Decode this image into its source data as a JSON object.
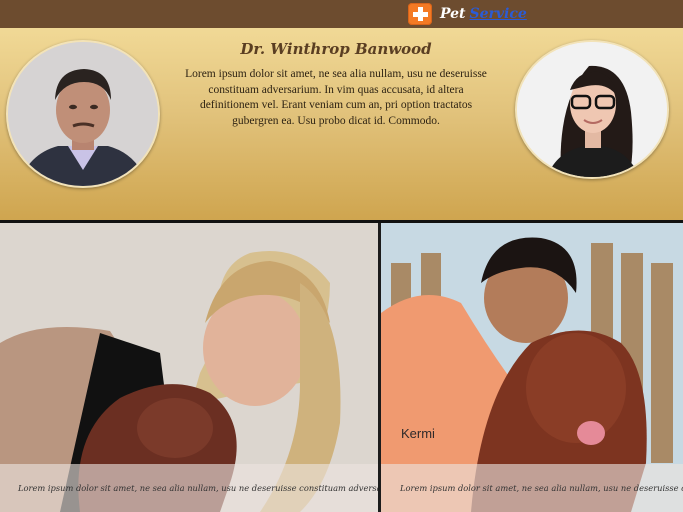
{
  "brand": {
    "word1": "Pet",
    "word2": "Service",
    "accent": "#f47a24",
    "link_color": "#2a5bd7",
    "logo_icon": "plus-cross-icon"
  },
  "profile": {
    "name": "Dr. Winthrop Banwood",
    "bio": "Lorem ipsum dolor sit amet, ne sea alia nullam, usu ne deseruisse constituam adversarium. In vim quas accusata, id altera definitionem vel. Erant veniam cum an, pri option tractatos gubergren ea. Usu probo dicat id. Commodo."
  },
  "gallery": [
    {
      "caption": "Lorem ipsum dolor sit amet, ne sea alia nullam, usu ne deseruisse constituam adversarium. ..."
    },
    {
      "caption": "Lorem ipsum dolor sit amet, ne sea alia nullam, usu ne deseruisse constituam ad"
    }
  ],
  "colors": {
    "topbar": "#6d4c2f",
    "hero_top": "#f1d996",
    "hero_bottom": "#cfa54f"
  }
}
